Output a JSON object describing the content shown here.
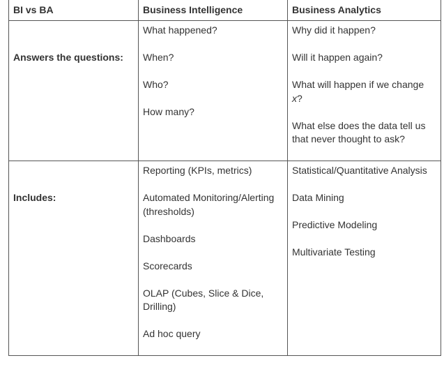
{
  "table": {
    "headers": [
      "BI vs BA",
      "Business Intelligence",
      "Business Analytics"
    ],
    "rows": [
      {
        "label": "Answers the questions:",
        "bi": [
          "What happened?",
          "When?",
          "Who?",
          "How many?"
        ],
        "ba": [
          "Why did it happen?",
          "Will it happen again?",
          "What will happen if we change",
          "x",
          "?",
          "What else does the data tell us that never thought to ask?"
        ]
      },
      {
        "label": "Includes:",
        "bi": [
          "Reporting (KPIs, metrics)",
          "Automated Monitoring/Alerting (thresholds)",
          "Dashboards",
          "Scorecards",
          "OLAP (Cubes, Slice & Dice, Drilling)",
          "Ad hoc query"
        ],
        "ba": [
          "Statistical/Quantitative Analysis",
          "Data Mining",
          "Predictive Modeling",
          "Multivariate Testing"
        ]
      }
    ]
  }
}
